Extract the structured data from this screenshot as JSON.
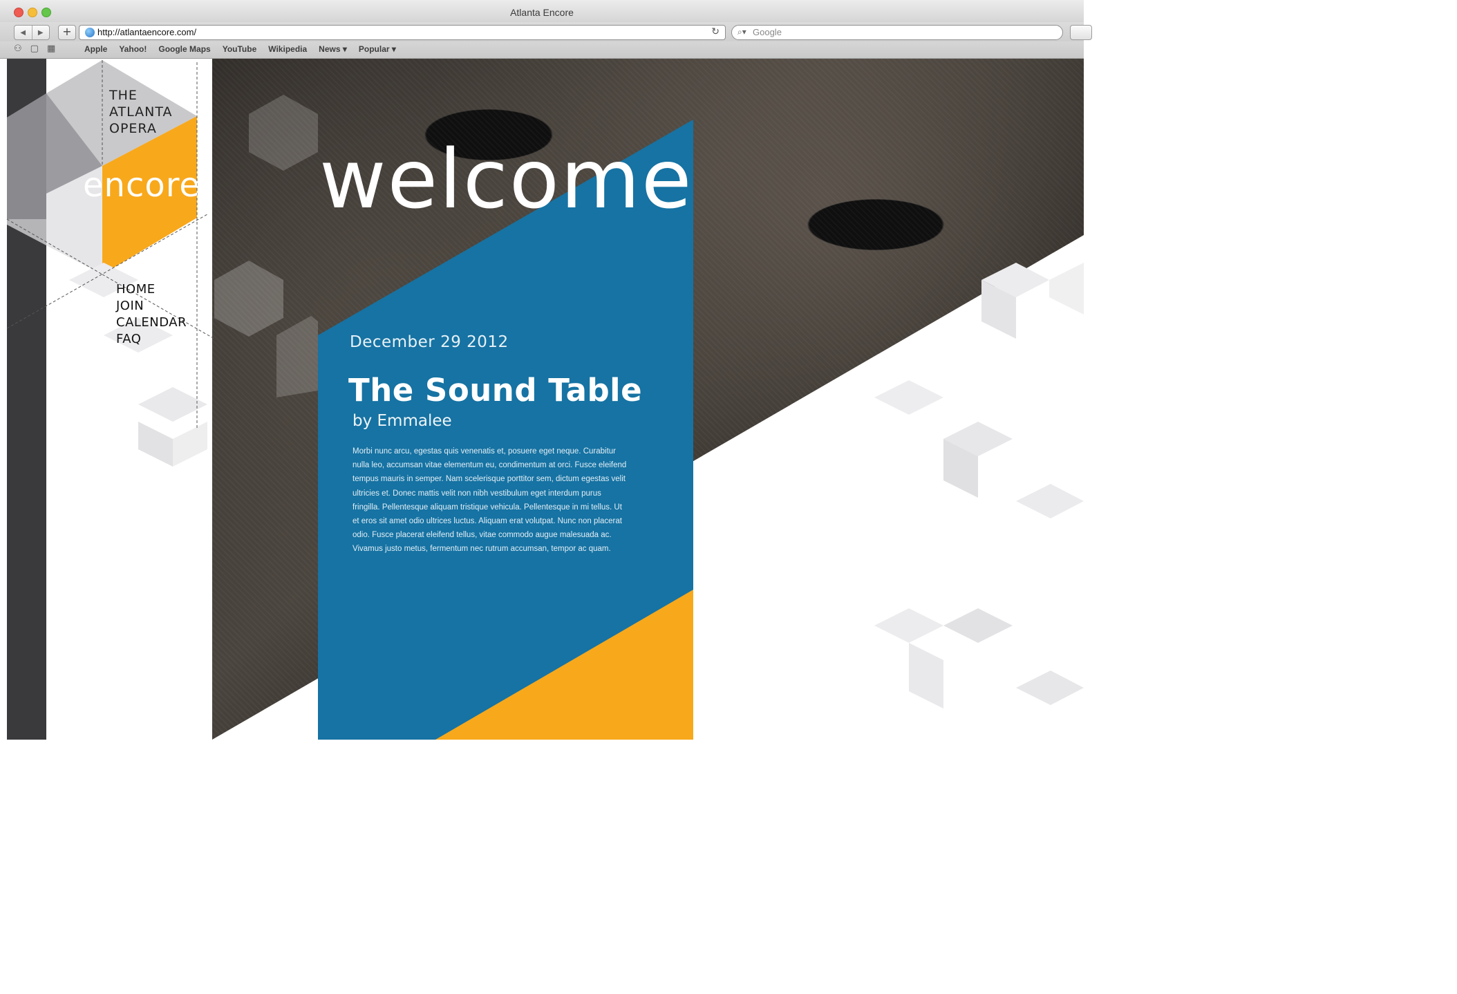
{
  "window": {
    "title": "Atlanta Encore"
  },
  "toolbar": {
    "back": "◀",
    "forward": "▶",
    "new_tab": "+",
    "url": "http://atlantaencore.com/",
    "reload": "↻",
    "search_placeholder": "Google",
    "search_icon": "search-icon"
  },
  "bookmarks": {
    "icons": [
      "reading-list-icon",
      "bookmarks-book-icon",
      "top-sites-grid-icon"
    ],
    "items": [
      "Apple",
      "Yahoo!",
      "Google Maps",
      "YouTube",
      "Wikipedia",
      "News ▾",
      "Popular ▾"
    ]
  },
  "brand": {
    "line1": "THE",
    "line2": "ATLANTA",
    "line3": "OPERA",
    "wordmark": "encore"
  },
  "nav": [
    "HOME",
    "JOIN",
    "CALENDAR",
    "FAQ"
  ],
  "hero": {
    "heading": "welcome"
  },
  "article": {
    "date": "December 29 2012",
    "title": "The Sound Table",
    "byline": "by Emmalee",
    "body": "Morbi nunc arcu, egestas quis venenatis et, posuere eget neque. Curabitur nulla leo, accumsan vitae elementum eu, condimentum at orci. Fusce eleifend tempus mauris in semper. Nam scelerisque porttitor sem, dictum egestas velit ultricies et. Donec mattis velit non nibh vestibulum eget interdum purus fringilla. Pellentesque aliquam tristique vehicula. Pellentesque in mi tellus. Ut et eros sit amet odio ultrices luctus. Aliquam erat volutpat. Nunc non placerat odio. Fusce placerat eleifend tellus, vitae commodo augue malesuada ac. Vivamus justo metus, fermentum nec rutrum accumsan, tempor ac quam."
  },
  "colors": {
    "blue": "#1673a3",
    "orange": "#f8a81b",
    "rail": "#3a3a3c",
    "gray": "#c8c8ca"
  }
}
